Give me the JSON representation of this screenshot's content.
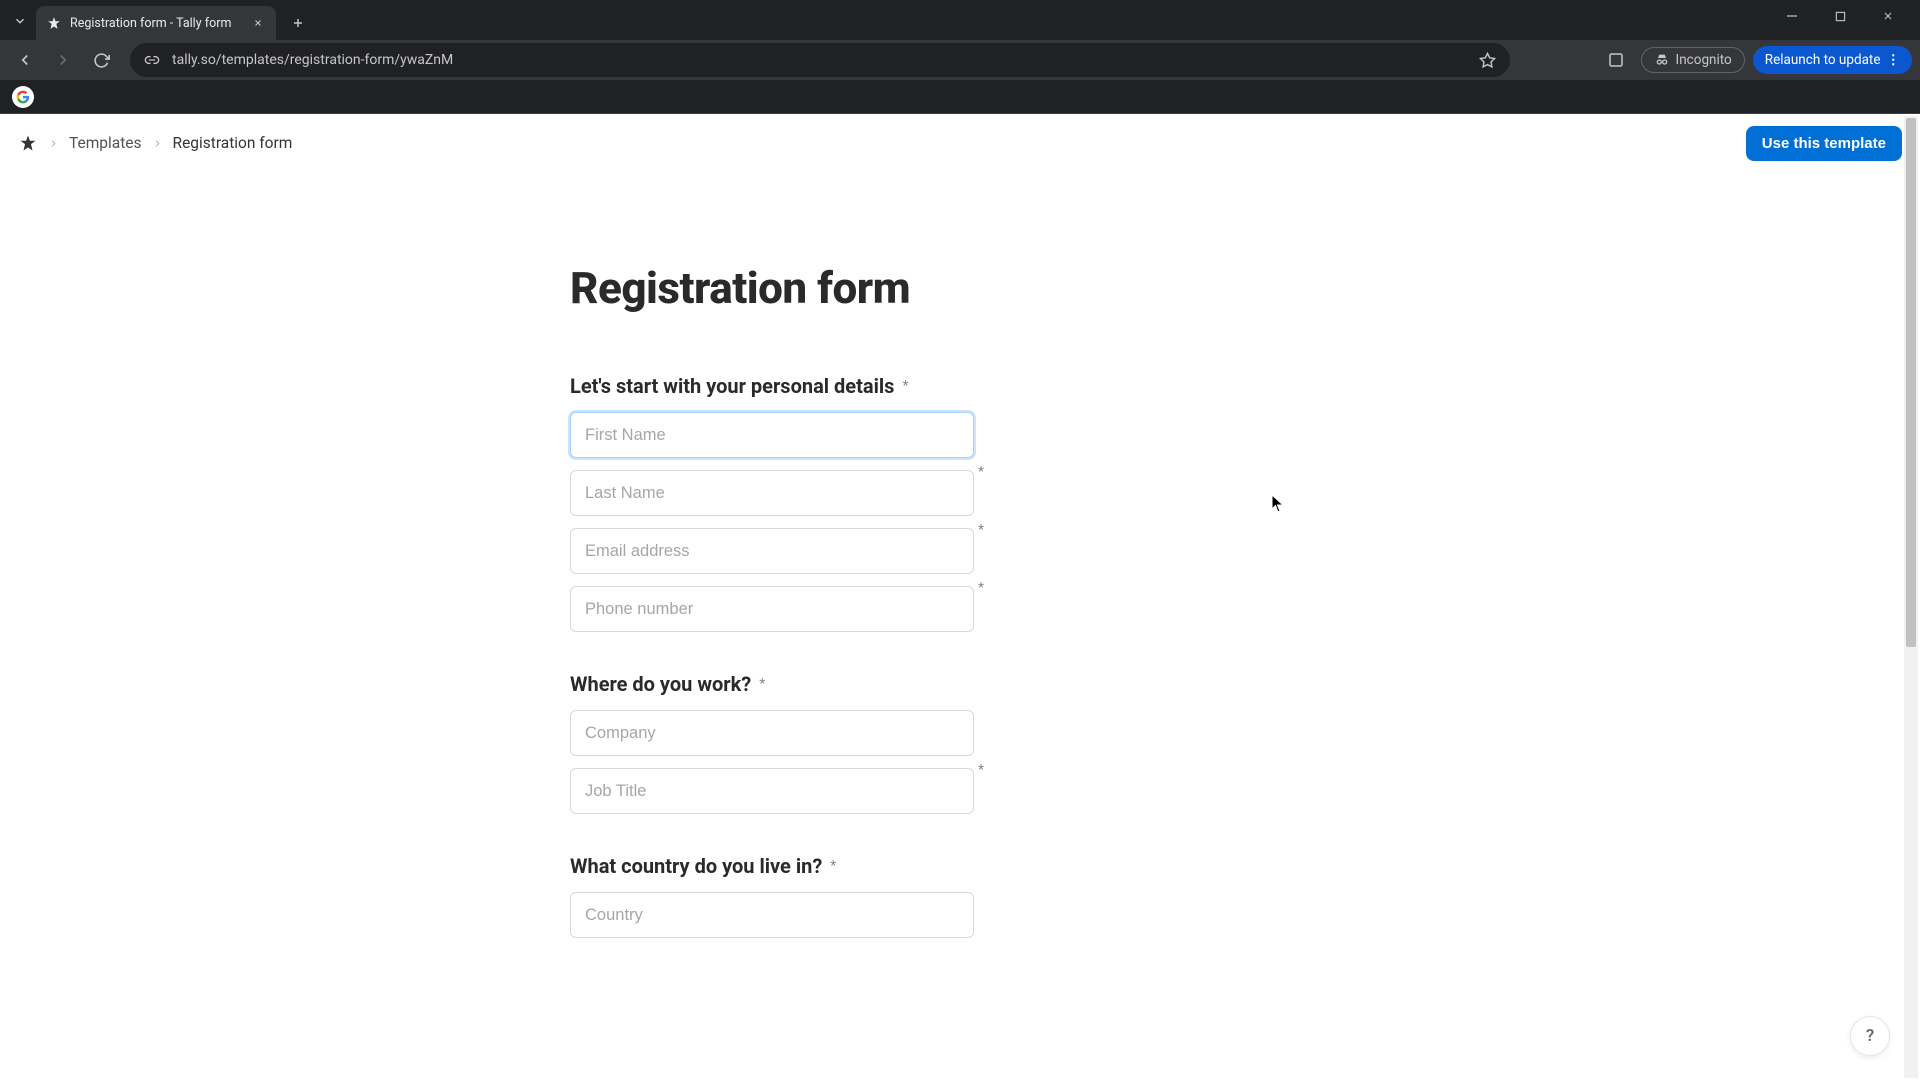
{
  "browser": {
    "tab_title": "Registration form - Tally form",
    "url": "tally.so/templates/registration-form/ywaZnM",
    "incognito_label": "Incognito",
    "relaunch_label": "Relaunch to update"
  },
  "header": {
    "crumb_templates": "Templates",
    "crumb_current": "Registration form",
    "use_template_label": "Use this template"
  },
  "form": {
    "title": "Registration form",
    "section_personal": "Let's start with your personal details",
    "fields": {
      "first_name_placeholder": "First Name",
      "last_name_placeholder": "Last Name",
      "email_placeholder": "Email address",
      "phone_placeholder": "Phone number"
    },
    "section_work": "Where do you work?",
    "work_fields": {
      "company_placeholder": "Company",
      "job_title_placeholder": "Job Title"
    },
    "section_country": "What country do you live in?",
    "country_fields": {
      "country_placeholder": "Country"
    }
  },
  "help_label": "?"
}
